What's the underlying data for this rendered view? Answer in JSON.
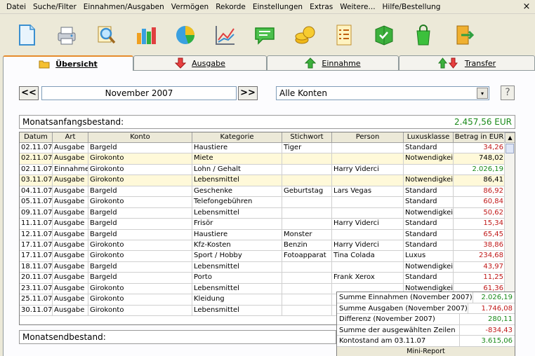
{
  "menu": [
    "Datei",
    "Suche/Filter",
    "Einnahmen/Ausgaben",
    "Vermögen",
    "Rekorde",
    "Einstellungen",
    "Extras",
    "Weitere...",
    "Hilfe/Bestellung"
  ],
  "close_glyph": "×",
  "toolbar_icons": [
    "new-document-icon",
    "printer-icon",
    "magnifier-icon",
    "bar-chart-icon",
    "pie-chart-icon",
    "line-chart-icon",
    "message-icon",
    "coins-icon",
    "checklist-icon",
    "book-icon",
    "shopping-bag-icon",
    "exit-door-icon"
  ],
  "tabs": [
    {
      "label": "Übersicht",
      "icon": "folder-icon",
      "active": true
    },
    {
      "label": "Ausgabe",
      "icon": "arrow-down-icon",
      "active": false
    },
    {
      "label": "Einnahme",
      "icon": "arrow-up-icon",
      "active": false
    },
    {
      "label": "Transfer",
      "icon": "transfer-arrows-icon",
      "active": false
    }
  ],
  "nav": {
    "prev_label": "<<",
    "next_label": ">>",
    "month": "November 2007"
  },
  "account_filter": {
    "value": "Alle Konten",
    "dropdown_glyph": "▾"
  },
  "help_label": "?",
  "opening_balance": {
    "label": "Monatsanfangsbestand:",
    "value": "2.457,56 EUR"
  },
  "closing_balance": {
    "label": "Monatsendbestand:"
  },
  "table": {
    "columns": [
      "Datum",
      "Art",
      "Konto",
      "Kategorie",
      "Stichwort",
      "Person",
      "Luxusklasse",
      "Betrag in EUR"
    ],
    "rows": [
      [
        "02.11.07",
        "Ausgabe",
        "Bargeld",
        "Haustiere",
        "Tiger",
        "",
        "Standard",
        "34,26"
      ],
      [
        "02.11.07",
        "Ausgabe",
        "Girokonto",
        "Miete",
        "",
        "",
        "Notwendigkeit",
        "748,02"
      ],
      [
        "02.11.07",
        "Einnahme",
        "Girokonto",
        "Lohn / Gehalt",
        "",
        "Harry Viderci",
        "",
        "2.026,19"
      ],
      [
        "03.11.07",
        "Ausgabe",
        "Girokonto",
        "Lebensmittel",
        "",
        "",
        "Notwendigkeit",
        "86,41"
      ],
      [
        "04.11.07",
        "Ausgabe",
        "Bargeld",
        "Geschenke",
        "Geburtstag",
        "Lars Vegas",
        "Standard",
        "86,92"
      ],
      [
        "05.11.07",
        "Ausgabe",
        "Girokonto",
        "Telefongebühren",
        "",
        "",
        "Standard",
        "60,84"
      ],
      [
        "09.11.07",
        "Ausgabe",
        "Bargeld",
        "Lebensmittel",
        "",
        "",
        "Notwendigkeit",
        "50,62"
      ],
      [
        "11.11.07",
        "Ausgabe",
        "Bargeld",
        "Frisör",
        "",
        "Harry Viderci",
        "Standard",
        "15,34"
      ],
      [
        "12.11.07",
        "Ausgabe",
        "Bargeld",
        "Haustiere",
        "Monster",
        "",
        "Standard",
        "65,45"
      ],
      [
        "17.11.07",
        "Ausgabe",
        "Girokonto",
        "Kfz-Kosten",
        "Benzin",
        "Harry Viderci",
        "Standard",
        "38,86"
      ],
      [
        "17.11.07",
        "Ausgabe",
        "Girokonto",
        "Sport / Hobby",
        "Fotoapparat",
        "Tina Colada",
        "Luxus",
        "234,68"
      ],
      [
        "18.11.07",
        "Ausgabe",
        "Bargeld",
        "Lebensmittel",
        "",
        "",
        "Notwendigkeit",
        "43,97"
      ],
      [
        "20.11.07",
        "Ausgabe",
        "Bargeld",
        "Porto",
        "",
        "Frank Xerox",
        "Standard",
        "11,25"
      ],
      [
        "23.11.07",
        "Ausgabe",
        "Girokonto",
        "Lebensmittel",
        "",
        "",
        "Notwendigkeit",
        "61,36"
      ],
      [
        "25.11.07",
        "Ausgabe",
        "Girokonto",
        "Kleidung",
        "",
        "",
        "",
        ""
      ],
      [
        "30.11.07",
        "Ausgabe",
        "Girokonto",
        "Lebensmittel",
        "",
        "",
        "",
        ""
      ]
    ],
    "row_types": [
      "neg",
      "sel",
      "pos",
      "sel",
      "neg",
      "neg",
      "neg",
      "neg",
      "neg",
      "neg",
      "neg",
      "neg",
      "neg",
      "neg",
      "neg",
      "neg"
    ]
  },
  "scroll_glyphs": {
    "up": "▲"
  },
  "mini_report": {
    "title": "Mini-Report",
    "rows": [
      {
        "label": "Summe Einnahmen (November 2007)",
        "value": "2.026,19",
        "color": "#1a8a1a"
      },
      {
        "label": "Summe Ausgaben (November 2007)",
        "value": "1.746,08",
        "color": "#c01818"
      },
      {
        "label": "Differenz (November 2007)",
        "value": "280,11",
        "color": "#1a8a1a"
      },
      {
        "label": "Summe der ausgewählten Zeilen",
        "value": "-834,43",
        "color": "#c01818"
      },
      {
        "label": "Kontostand am 03.11.07",
        "value": "3.615,06",
        "color": "#1a8a1a"
      }
    ]
  }
}
